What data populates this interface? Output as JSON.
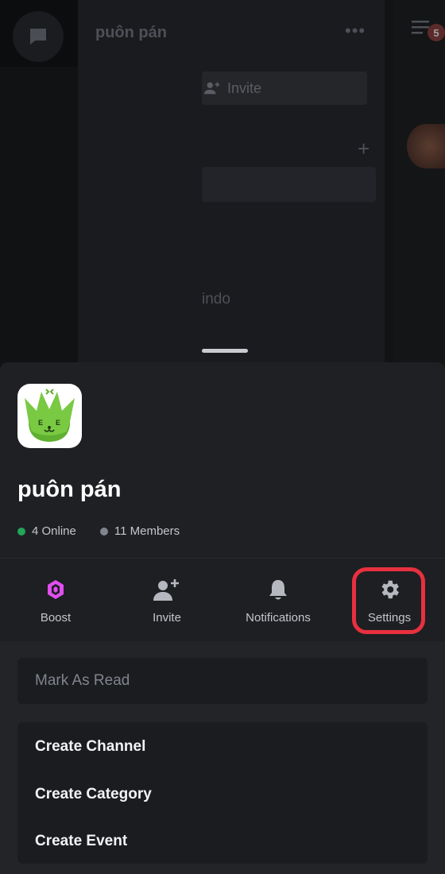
{
  "background": {
    "channel_title": "puôn pán",
    "invite_label": "Invite",
    "partial_text": "indo",
    "notification_count": "5"
  },
  "guild": {
    "name": "puôn pán",
    "online": "4 Online",
    "members": "11 Members"
  },
  "actions": {
    "boost": "Boost",
    "invite": "Invite",
    "notifications": "Notifications",
    "settings": "Settings"
  },
  "menu": {
    "mark_as_read": "Mark As Read",
    "create_channel": "Create Channel",
    "create_category": "Create Category",
    "create_event": "Create Event"
  },
  "colors": {
    "online": "#23a55a",
    "boost": "#e04ef0",
    "highlight": "#e8303f",
    "guild_icon_green": "#7ac943"
  }
}
